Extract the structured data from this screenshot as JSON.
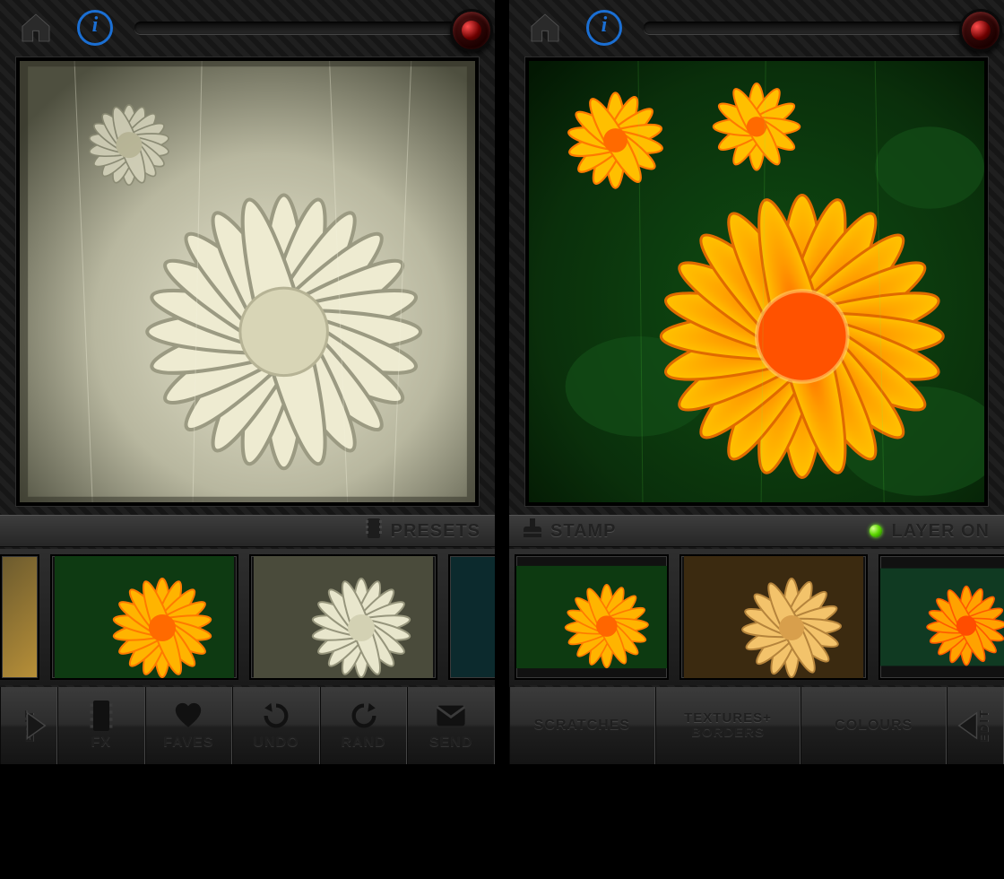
{
  "left": {
    "section": {
      "right_icon": "film-icon",
      "right_label": "PRESETS"
    },
    "thumbs": [
      "preset-1",
      "preset-2",
      "preset-3",
      "preset-4"
    ],
    "buttons": {
      "edit": "EDIT",
      "fx": "FX",
      "faves": "FAVES",
      "undo": "UNDO",
      "rand": "RAND",
      "send": "SEND"
    }
  },
  "right": {
    "section": {
      "left_icon": "stamp-icon",
      "left_label": "STAMP",
      "right_label": "LAYER ON"
    },
    "thumbs": [
      "layer-1",
      "layer-2",
      "layer-3"
    ],
    "buttons": {
      "scratches": "SCRATCHES",
      "textures_line1": "TEXTURES+",
      "textures_line2": "BORDERS",
      "colours": "COLOURS",
      "edit": "EDIT"
    }
  }
}
